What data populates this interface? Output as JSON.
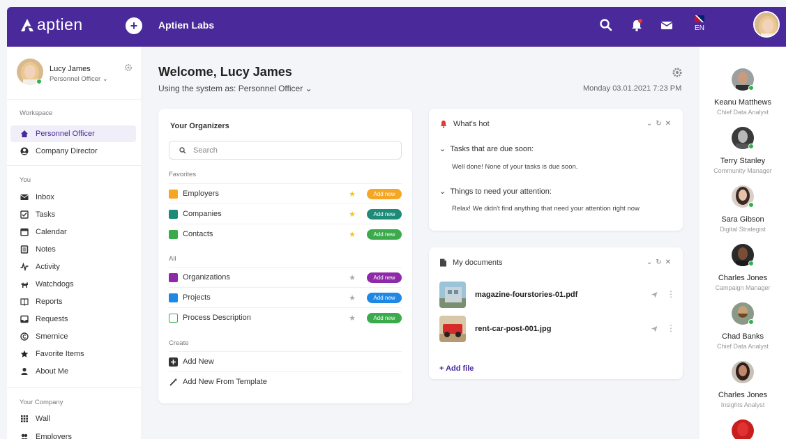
{
  "header": {
    "logo_text": "aptien",
    "company": "Aptien Labs",
    "lang": "EN",
    "icons": [
      "search-icon",
      "bell-icon",
      "mail-icon",
      "flag-icon"
    ],
    "brand_color": "#4a2a9a"
  },
  "profile": {
    "name": "Lucy James",
    "role": "Personnel Officer"
  },
  "sidebar": {
    "workspace_label": "Workspace",
    "workspace_items": [
      {
        "label": "Personnel Officer",
        "icon": "home-icon",
        "active": true
      },
      {
        "label": "Company Director",
        "icon": "user-circle-icon",
        "active": false
      }
    ],
    "you_label": "You",
    "you_items": [
      {
        "label": "Inbox",
        "icon": "mail-icon"
      },
      {
        "label": "Tasks",
        "icon": "checkbox-icon"
      },
      {
        "label": "Calendar",
        "icon": "calendar-icon"
      },
      {
        "label": "Notes",
        "icon": "notes-icon"
      },
      {
        "label": "Activity",
        "icon": "activity-icon"
      },
      {
        "label": "Watchdogs",
        "icon": "dog-icon"
      },
      {
        "label": "Reports",
        "icon": "book-icon"
      },
      {
        "label": "Requests",
        "icon": "inbox-tray-icon"
      },
      {
        "label": "Smernice",
        "icon": "copyright-icon"
      },
      {
        "label": "Favorite Items",
        "icon": "star-icon"
      },
      {
        "label": "About Me",
        "icon": "person-icon"
      }
    ],
    "company_label": "Your Company",
    "company_items": [
      {
        "label": "Wall",
        "icon": "grid-icon"
      },
      {
        "label": "Employers",
        "icon": "people-icon"
      }
    ]
  },
  "main": {
    "welcome": "Welcome, Lucy James",
    "using_label": "Using the system as: Personnel Officer",
    "date": "Monday 03.01.2021 7:23 PM"
  },
  "organizers": {
    "title": "Your Organizers",
    "search_placeholder": "Search",
    "favorites_label": "Favorites",
    "favorites": [
      {
        "label": "Employers",
        "icon": "employers-icon",
        "color": "#f5a623",
        "pill": "Add new",
        "pill_color": "#f5a623",
        "starred": true
      },
      {
        "label": "Companies",
        "icon": "companies-icon",
        "color": "#1e8a78",
        "pill": "Add new",
        "pill_color": "#1e8a78",
        "starred": true
      },
      {
        "label": "Contacts",
        "icon": "contacts-icon",
        "color": "#3aaa4a",
        "pill": "Add new",
        "pill_color": "#3aaa4a",
        "starred": true
      }
    ],
    "all_label": "All",
    "all": [
      {
        "label": "Organizations",
        "icon": "organizations-icon",
        "color": "#8e2aa8",
        "pill": "Add new",
        "pill_color": "#8e2aa8",
        "starred": false
      },
      {
        "label": "Projects",
        "icon": "projects-icon",
        "color": "#1e88e5",
        "pill": "Add new",
        "pill_color": "#1e88e5",
        "starred": false
      },
      {
        "label": "Process Description",
        "icon": "process-icon",
        "color": "#3aaa4a",
        "pill": "Add new",
        "pill_color": "#3aaa4a",
        "starred": false
      }
    ],
    "create_label": "Create",
    "create": [
      {
        "label": "Add New",
        "icon": "add-square-icon"
      },
      {
        "label": "Add New From Template",
        "icon": "magic-wand-icon"
      }
    ]
  },
  "whats_hot": {
    "title": "What's hot",
    "sections": [
      {
        "title": "Tasks that are due soon:",
        "text": "Well done! None of your tasks is due soon."
      },
      {
        "title": "Things to need your attention:",
        "text": "Relax! We didn't find anything that need your attention right now"
      }
    ]
  },
  "documents": {
    "title": "My documents",
    "files": [
      {
        "name": "magazine-fourstories-01.pdf"
      },
      {
        "name": "rent-car-post-001.jpg"
      }
    ],
    "add_label": "+ Add file"
  },
  "people": [
    {
      "name": "Keanu Matthews",
      "title": "Chief Data Analyst"
    },
    {
      "name": "Terry Stanley",
      "title": "Community Manager"
    },
    {
      "name": "Sara Gibson",
      "title": "Digital Strategist"
    },
    {
      "name": "Charles Jones",
      "title": "Campaign Manager"
    },
    {
      "name": "Chad Banks",
      "title": "Chief Data Analyst"
    },
    {
      "name": "Charles Jones",
      "title": "Insights Analyst"
    },
    {
      "name": "",
      "title": ""
    }
  ]
}
